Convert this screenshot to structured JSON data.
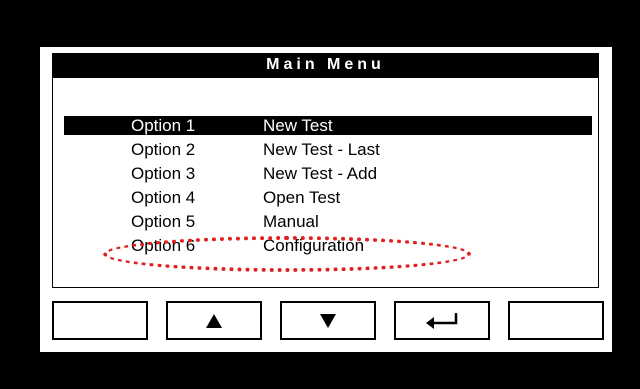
{
  "screen": {
    "title": "Main Menu"
  },
  "menu": {
    "selected_index": 0,
    "items": [
      {
        "option": "Option 1",
        "label": "New Test"
      },
      {
        "option": "Option 2",
        "label": "New Test - Last"
      },
      {
        "option": "Option 3",
        "label": "New Test - Add"
      },
      {
        "option": "Option 4",
        "label": "Open Test"
      },
      {
        "option": "Option 5",
        "label": "Manual"
      },
      {
        "option": "Option 6",
        "label": "Configuration"
      }
    ]
  },
  "annotation": {
    "highlight_color": "#e02020",
    "highlighted_item_index": 4
  },
  "softkeys": [
    {
      "icon": "blank"
    },
    {
      "icon": "arrow-up-icon"
    },
    {
      "icon": "arrow-down-icon"
    },
    {
      "icon": "enter-icon"
    },
    {
      "icon": "blank"
    }
  ]
}
